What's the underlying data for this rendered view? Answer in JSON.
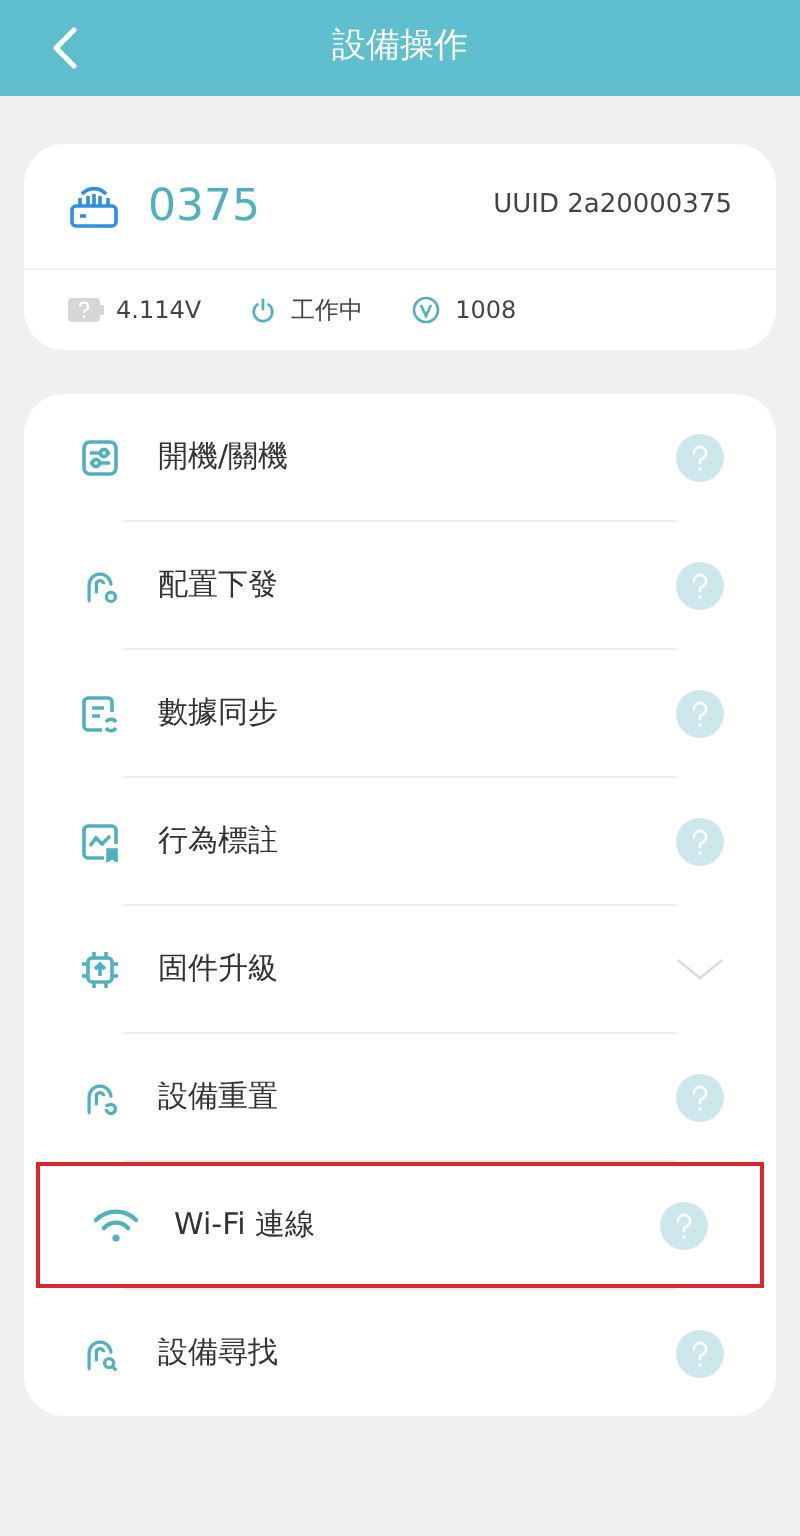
{
  "header": {
    "title": "設備操作"
  },
  "device": {
    "name": "0375",
    "uuid": "UUID 2a20000375",
    "voltage": "4.114V",
    "status": "工作中",
    "version": "1008"
  },
  "operations": [
    {
      "label": "開機/關機",
      "kind": "help",
      "highlighted": false
    },
    {
      "label": "配置下發",
      "kind": "help",
      "highlighted": false
    },
    {
      "label": "數據同步",
      "kind": "help",
      "highlighted": false
    },
    {
      "label": "行為標註",
      "kind": "help",
      "highlighted": false
    },
    {
      "label": "固件升級",
      "kind": "expand",
      "highlighted": false
    },
    {
      "label": "設備重置",
      "kind": "help",
      "highlighted": false
    },
    {
      "label": "Wi-Fi 連線",
      "kind": "help",
      "highlighted": true
    },
    {
      "label": "設備尋找",
      "kind": "help",
      "highlighted": false
    }
  ]
}
